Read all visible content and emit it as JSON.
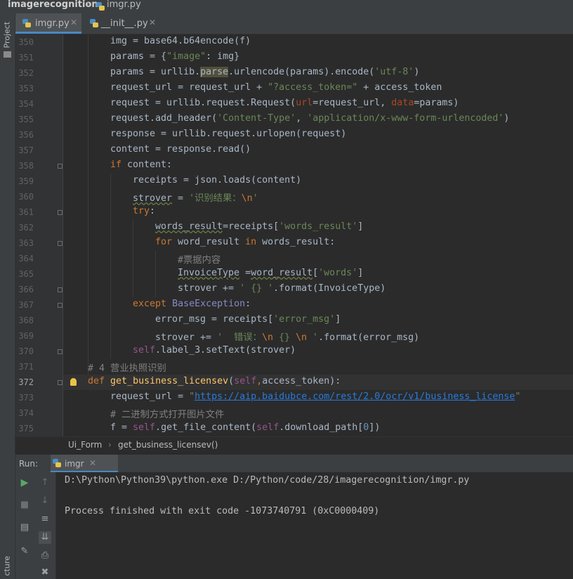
{
  "nav": {
    "project": "imagerecognition",
    "file": "imgr.py"
  },
  "left_strip": {
    "top_label": "Project",
    "bottom_label": "cture"
  },
  "tabs": [
    {
      "label": "imgr.py",
      "active": true
    },
    {
      "label": "__init__.py",
      "active": false
    }
  ],
  "editor": {
    "current_line": "372",
    "lines": [
      {
        "n": "350",
        "indent": 4,
        "tokens": [
          [
            "img = base64.b64encode(f)",
            ""
          ]
        ]
      },
      {
        "n": "351",
        "indent": 4,
        "tokens": [
          [
            "params = {",
            ""
          ],
          [
            "\"image\"",
            "str"
          ],
          [
            ": img}",
            ""
          ]
        ]
      },
      {
        "n": "352",
        "indent": 4,
        "tokens": [
          [
            "params = urllib.",
            ""
          ],
          [
            "parse",
            "hl"
          ],
          [
            ".urlencode(params).encode(",
            ""
          ],
          [
            "'utf-8'",
            "str"
          ],
          [
            ")",
            ""
          ]
        ]
      },
      {
        "n": "353",
        "indent": 4,
        "tokens": [
          [
            "request_url = request_url + ",
            ""
          ],
          [
            "\"?access_token=\"",
            "str"
          ],
          [
            " + access_token",
            ""
          ]
        ]
      },
      {
        "n": "354",
        "indent": 4,
        "tokens": [
          [
            "request = urllib.request.Request(",
            ""
          ],
          [
            "url",
            "param"
          ],
          [
            "=request_url, ",
            ""
          ],
          [
            "data",
            "param"
          ],
          [
            "=params)",
            ""
          ]
        ]
      },
      {
        "n": "355",
        "indent": 4,
        "tokens": [
          [
            "request.add_header(",
            ""
          ],
          [
            "'Content-Type'",
            "str"
          ],
          [
            ", ",
            ""
          ],
          [
            "'application/x-www-form-urlencoded'",
            "str"
          ],
          [
            ")",
            ""
          ]
        ]
      },
      {
        "n": "356",
        "indent": 4,
        "tokens": [
          [
            "response = urllib.request.urlopen(request)",
            ""
          ]
        ]
      },
      {
        "n": "357",
        "indent": 4,
        "tokens": [
          [
            "content = response.read()",
            ""
          ]
        ]
      },
      {
        "n": "358",
        "indent": 4,
        "fold": true,
        "tokens": [
          [
            "if",
            "kw"
          ],
          [
            " content:",
            ""
          ]
        ]
      },
      {
        "n": "359",
        "indent": 8,
        "tokens": [
          [
            "receipts = json.loads(content)",
            ""
          ]
        ]
      },
      {
        "n": "360",
        "indent": 8,
        "tokens": [
          [
            "strover",
            "ul"
          ],
          [
            " = ",
            ""
          ],
          [
            "'识别结果：",
            "str"
          ],
          [
            "\\n",
            "kw"
          ],
          [
            "'",
            "str"
          ]
        ]
      },
      {
        "n": "361",
        "indent": 8,
        "fold": true,
        "tokens": [
          [
            "try",
            "kw"
          ],
          [
            ":",
            ""
          ]
        ]
      },
      {
        "n": "362",
        "indent": 12,
        "tokens": [
          [
            "words_result",
            "ul"
          ],
          [
            "=receipts[",
            ""
          ],
          [
            "'words_result'",
            "str"
          ],
          [
            "]",
            ""
          ]
        ]
      },
      {
        "n": "363",
        "indent": 12,
        "fold": true,
        "tokens": [
          [
            "for",
            "kw"
          ],
          [
            " word_result ",
            ""
          ],
          [
            "in",
            "kw"
          ],
          [
            " words_result:",
            ""
          ]
        ]
      },
      {
        "n": "364",
        "indent": 16,
        "tokens": [
          [
            "#票据内容",
            "com"
          ]
        ]
      },
      {
        "n": "365",
        "indent": 16,
        "tokens": [
          [
            "InvoiceType",
            "ul"
          ],
          [
            " =",
            ""
          ],
          [
            "word_result",
            "ul"
          ],
          [
            "[",
            ""
          ],
          [
            "'words'",
            "str"
          ],
          [
            "]",
            ""
          ]
        ]
      },
      {
        "n": "366",
        "indent": 16,
        "fold": true,
        "tokens": [
          [
            "strover += ",
            ""
          ],
          [
            "' {} '",
            "str"
          ],
          [
            ".format(InvoiceType)",
            ""
          ]
        ]
      },
      {
        "n": "367",
        "indent": 8,
        "fold": true,
        "tokens": [
          [
            "except",
            "kw"
          ],
          [
            " ",
            ""
          ],
          [
            "BaseException",
            "cls"
          ],
          [
            ":",
            ""
          ]
        ]
      },
      {
        "n": "368",
        "indent": 12,
        "tokens": [
          [
            "error_msg = receipts[",
            ""
          ],
          [
            "'error_msg'",
            "str"
          ],
          [
            "]",
            ""
          ]
        ]
      },
      {
        "n": "369",
        "indent": 12,
        "tokens": [
          [
            "strover += ",
            ""
          ],
          [
            "'  错误：",
            "str"
          ],
          [
            "\\n",
            "kw"
          ],
          [
            " {} ",
            "str"
          ],
          [
            "\\n",
            "kw"
          ],
          [
            " '",
            "str"
          ],
          [
            ".format(error_msg)",
            ""
          ]
        ]
      },
      {
        "n": "370",
        "indent": 8,
        "fold": true,
        "tokens": [
          [
            "self",
            "self"
          ],
          [
            ".label_3.setText(strover)",
            ""
          ]
        ]
      },
      {
        "n": "371",
        "indent": 0,
        "tokens": [
          [
            "# 4 营业执照识别",
            "com"
          ]
        ]
      },
      {
        "n": "372",
        "indent": 0,
        "fold": true,
        "bulb": true,
        "tokens": [
          [
            "def",
            "kw"
          ],
          [
            " ",
            ""
          ],
          [
            "get_business_licensev",
            "fn"
          ],
          [
            "(",
            ""
          ],
          [
            "self",
            "self"
          ],
          [
            ",",
            "kw"
          ],
          [
            "access_token):",
            ""
          ]
        ]
      },
      {
        "n": "373",
        "indent": 4,
        "tokens": [
          [
            "request_url = ",
            ""
          ],
          [
            "\"",
            "str"
          ],
          [
            "https://aip.baidubce.com/rest/2.0/ocr/v1/business_license",
            "url"
          ],
          [
            "\"",
            "str"
          ]
        ]
      },
      {
        "n": "374",
        "indent": 4,
        "tokens": [
          [
            "# 二进制方式打开图片文件",
            "com"
          ]
        ]
      },
      {
        "n": "375",
        "indent": 4,
        "tokens": [
          [
            "f = ",
            ""
          ],
          [
            "self",
            "self"
          ],
          [
            ".get_file_content(",
            ""
          ],
          [
            "self",
            "self"
          ],
          [
            ".download_path[",
            ""
          ],
          [
            "0",
            "num"
          ],
          [
            "])",
            ""
          ]
        ]
      }
    ]
  },
  "breadcrumb": {
    "class_name": "Ui_Form",
    "method_name": "get_business_licensev()"
  },
  "run": {
    "label": "Run:",
    "tab": "imgr",
    "output": [
      "D:\\Python\\Python39\\python.exe D:/Python/code/28/imagerecognition/imgr.py",
      "",
      "Process finished with exit code -1073740791 (0xC0000409)"
    ]
  },
  "colors": {
    "keyword": "#cc7832",
    "string": "#6a8759",
    "self": "#94558d",
    "function": "#ffc66d",
    "comment": "#808080",
    "accent": "#4a88c7"
  }
}
